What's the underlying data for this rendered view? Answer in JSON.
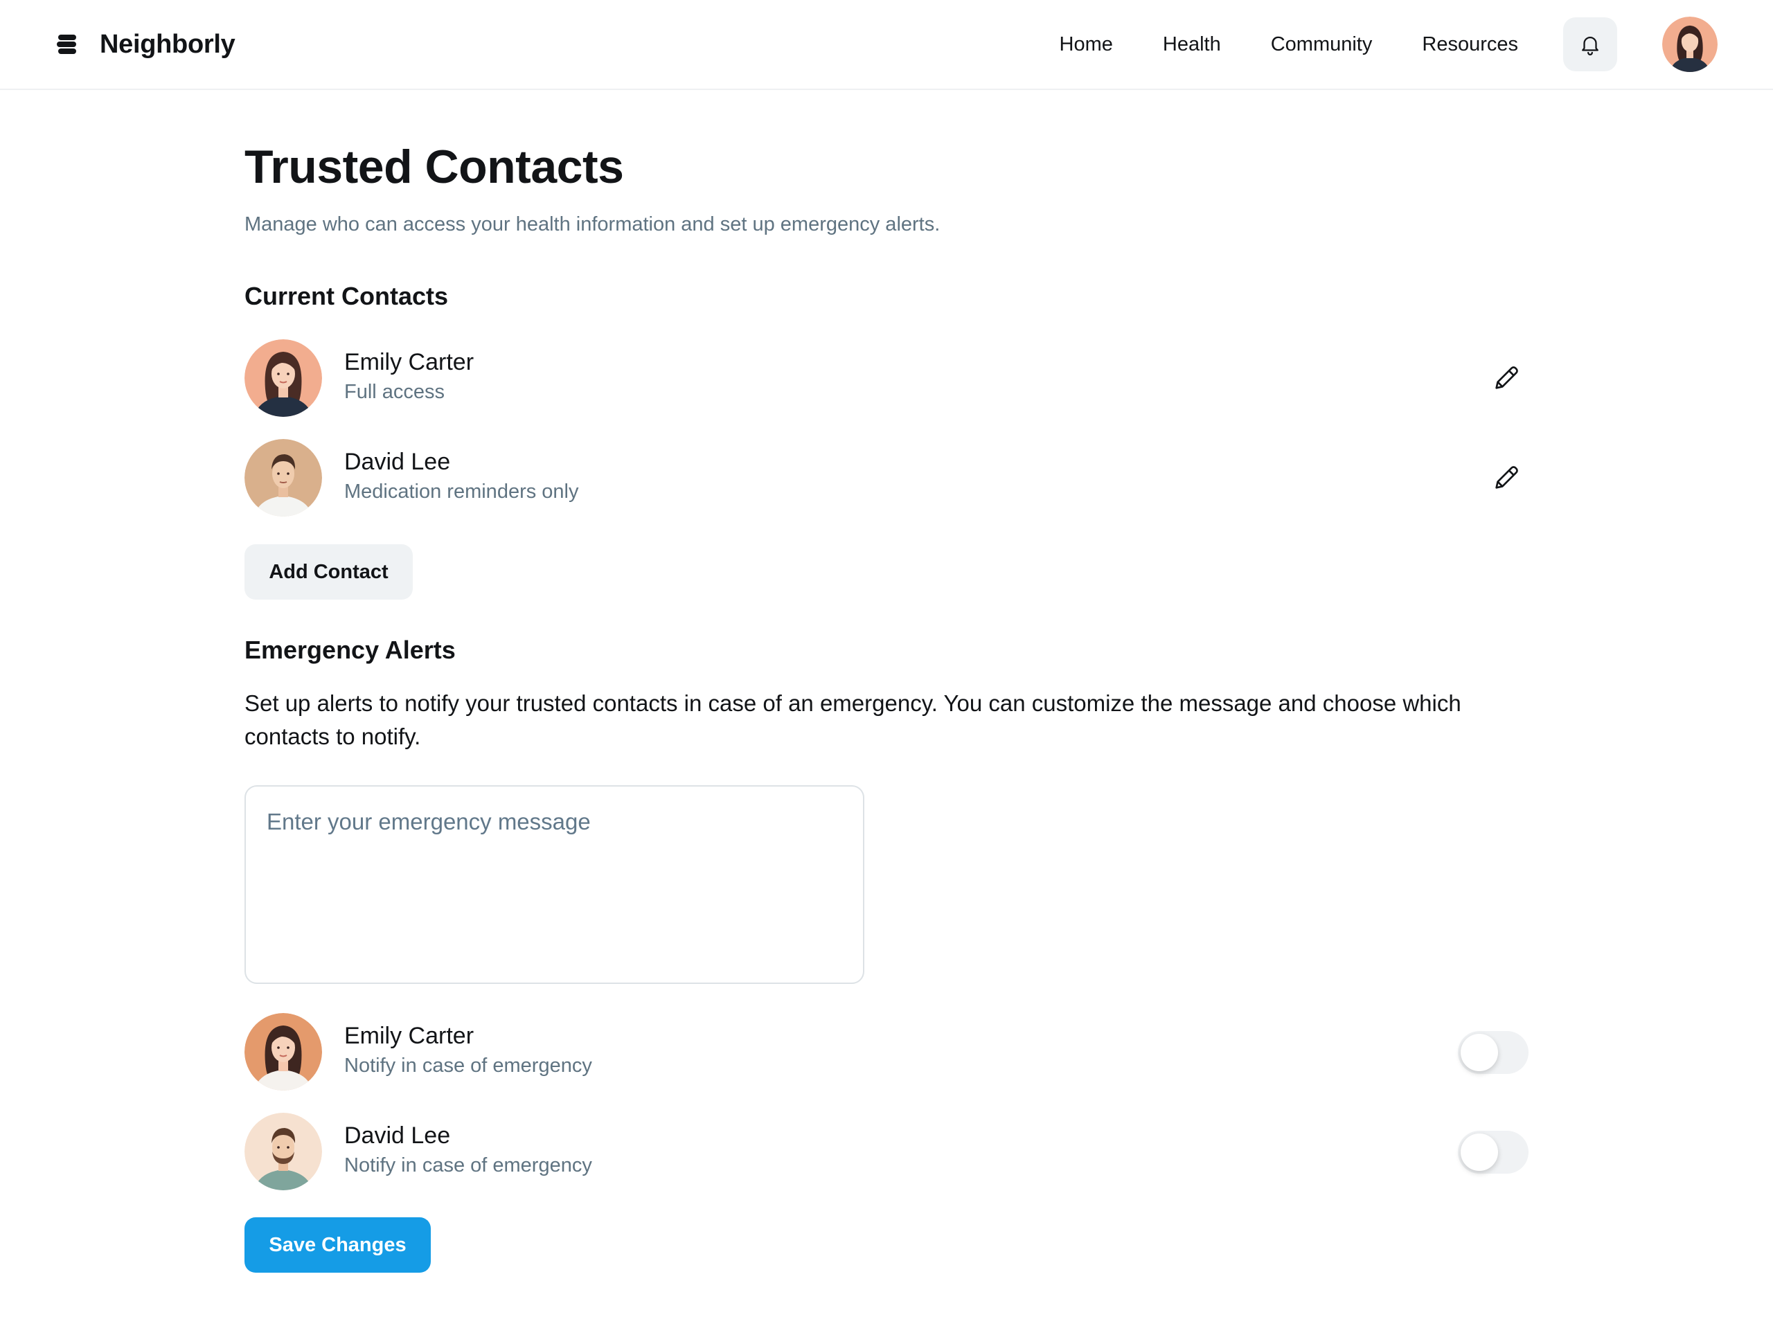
{
  "app": {
    "name": "Neighborly",
    "logo_icon": "stacked-layers-logo-icon"
  },
  "nav": {
    "items": [
      {
        "label": "Home"
      },
      {
        "label": "Health"
      },
      {
        "label": "Community"
      },
      {
        "label": "Resources"
      }
    ],
    "notifications_icon": "bell-icon"
  },
  "page": {
    "title": "Trusted Contacts",
    "subtitle": "Manage who can access your health information and set up emergency alerts."
  },
  "current_contacts": {
    "title": "Current Contacts",
    "items": [
      {
        "name": "Emily Carter",
        "access": "Full access",
        "edit_icon": "pencil-icon"
      },
      {
        "name": "David Lee",
        "access": "Medication reminders only",
        "edit_icon": "pencil-icon"
      }
    ],
    "add_button": "Add Contact"
  },
  "emergency_alerts": {
    "title": "Emergency Alerts",
    "description": "Set up alerts to notify your trusted contacts in case of an emergency. You can customize the message and choose which contacts to notify.",
    "message_placeholder": "Enter your emergency message",
    "message_value": "",
    "contacts": [
      {
        "name": "Emily Carter",
        "label": "Notify in case of emergency",
        "notify": false
      },
      {
        "name": "David Lee",
        "label": "Notify in case of emergency",
        "notify": false
      }
    ]
  },
  "save_button": "Save Changes",
  "colors": {
    "primary": "#159ce6",
    "muted_text": "#5f7381",
    "secondary_button": "#eff2f4"
  }
}
